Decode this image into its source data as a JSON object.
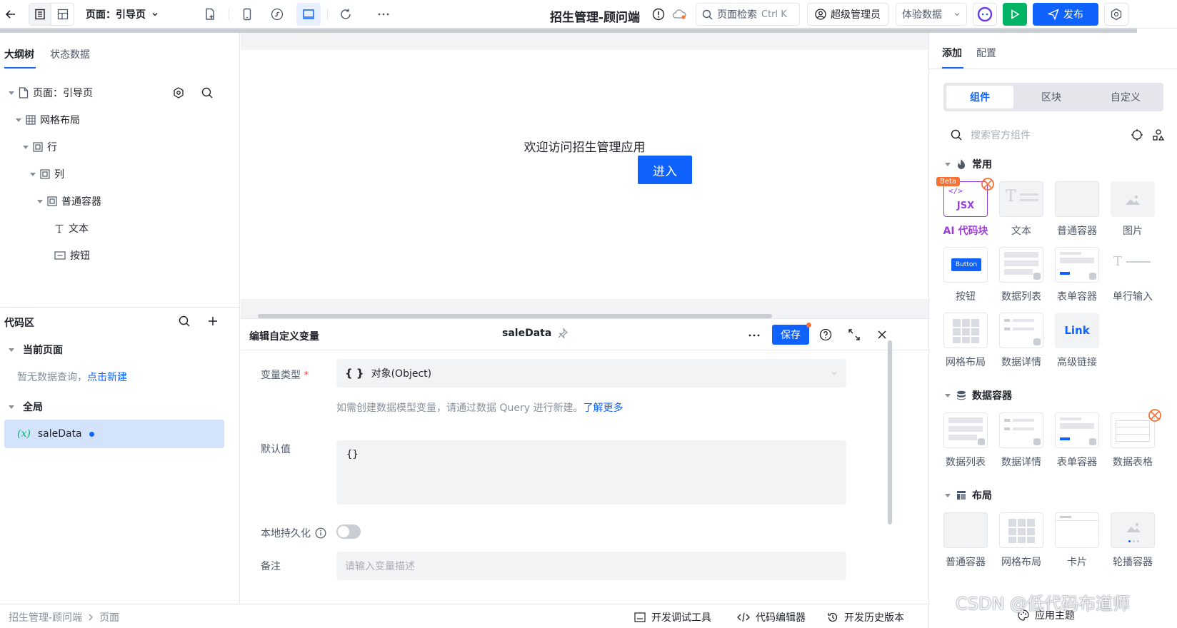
{
  "topbar": {
    "page_label": "页面：引导页",
    "app_title": "招生管理-顾问端",
    "search_label": "页面检索",
    "search_shortcut": "Ctrl K",
    "user_role": "超级管理员",
    "data_select": "体验数据",
    "publish_label": "发布"
  },
  "left_panel": {
    "tabs": [
      "大纲树",
      "状态数据"
    ],
    "tree": {
      "page": "页面：引导页",
      "grid": "网格布局",
      "row": "行",
      "col": "列",
      "container": "普通容器",
      "text": "文本",
      "button": "按钮"
    }
  },
  "code_area": {
    "title": "代码区",
    "current_page": "当前页面",
    "empty_text": "暂无数据查询，",
    "create_link": "点击新建",
    "global": "全局",
    "var_icon": "(x)",
    "var_name": "saleData"
  },
  "canvas": {
    "welcome_text": "欢迎访问招生管理应用",
    "enter_button": "进入"
  },
  "editor": {
    "title": "编辑自定义变量",
    "var_name": "saleData",
    "save_label": "保存",
    "fields": {
      "type_label": "变量类型",
      "required_mark": "*",
      "type_icon": "{ }",
      "type_value": "对象(Object)",
      "hint_text": "如需创建数据模型变量，请通过数据 Query 进行新建。",
      "hint_link": "了解更多",
      "default_label": "默认值",
      "default_value": "{}",
      "persist_label": "本地持久化",
      "note_label": "备注",
      "note_placeholder": "请输入变量描述"
    }
  },
  "right_panel": {
    "tabs": [
      "添加",
      "配置"
    ],
    "segments": [
      "组件",
      "区块",
      "自定义"
    ],
    "search_placeholder": "搜索官方组件",
    "categories": {
      "common": {
        "title": "常用",
        "items": [
          "AI 代码块",
          "文本",
          "普通容器",
          "图片",
          "按钮",
          "数据列表",
          "表单容器",
          "单行输入",
          "网格布局",
          "数据详情",
          "高级链接"
        ]
      },
      "data": {
        "title": "数据容器",
        "items": [
          "数据列表",
          "数据详情",
          "表单容器",
          "数据表格"
        ]
      },
      "layout": {
        "title": "布局",
        "items": [
          "普通容器",
          "网格布局",
          "卡片",
          "轮播容器"
        ]
      }
    },
    "badges": {
      "beta": "Beta",
      "jsx": "JSX",
      "button_thumb": "Button",
      "link_thumb": "Link"
    }
  },
  "bottombar": {
    "breadcrumb": [
      "招生管理-顾问端",
      "页面"
    ],
    "dev_tools": "开发调试工具",
    "code_editor": "代码编辑器",
    "history": "开发历史版本",
    "watermark": "CSDN @低代码布道师",
    "theme": "应用主题"
  },
  "colors": {
    "primary": "#0f62fe",
    "run_green": "#00b365",
    "ai_purple": "#9b3ddc",
    "beta_orange": "#f77234",
    "selected_row": "#d4e3fc"
  }
}
